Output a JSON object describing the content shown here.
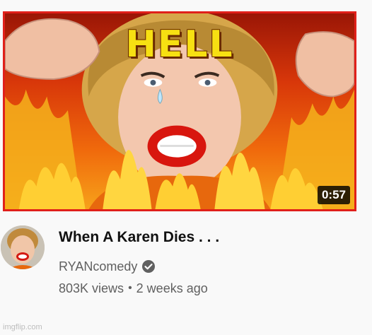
{
  "video": {
    "thumbnail_text": "HELL",
    "duration": "0:57",
    "title": "When A Karen Dies . . .",
    "channel": "RYANcomedy",
    "views": "803K views",
    "separator": "•",
    "age": "2 weeks ago"
  },
  "icons": {
    "verified": "check-circle-icon"
  },
  "colors": {
    "thumbnail_border": "#e0201a",
    "title_text": "#f7e012",
    "meta_text": "#606060"
  },
  "watermark": "imgflip.com"
}
